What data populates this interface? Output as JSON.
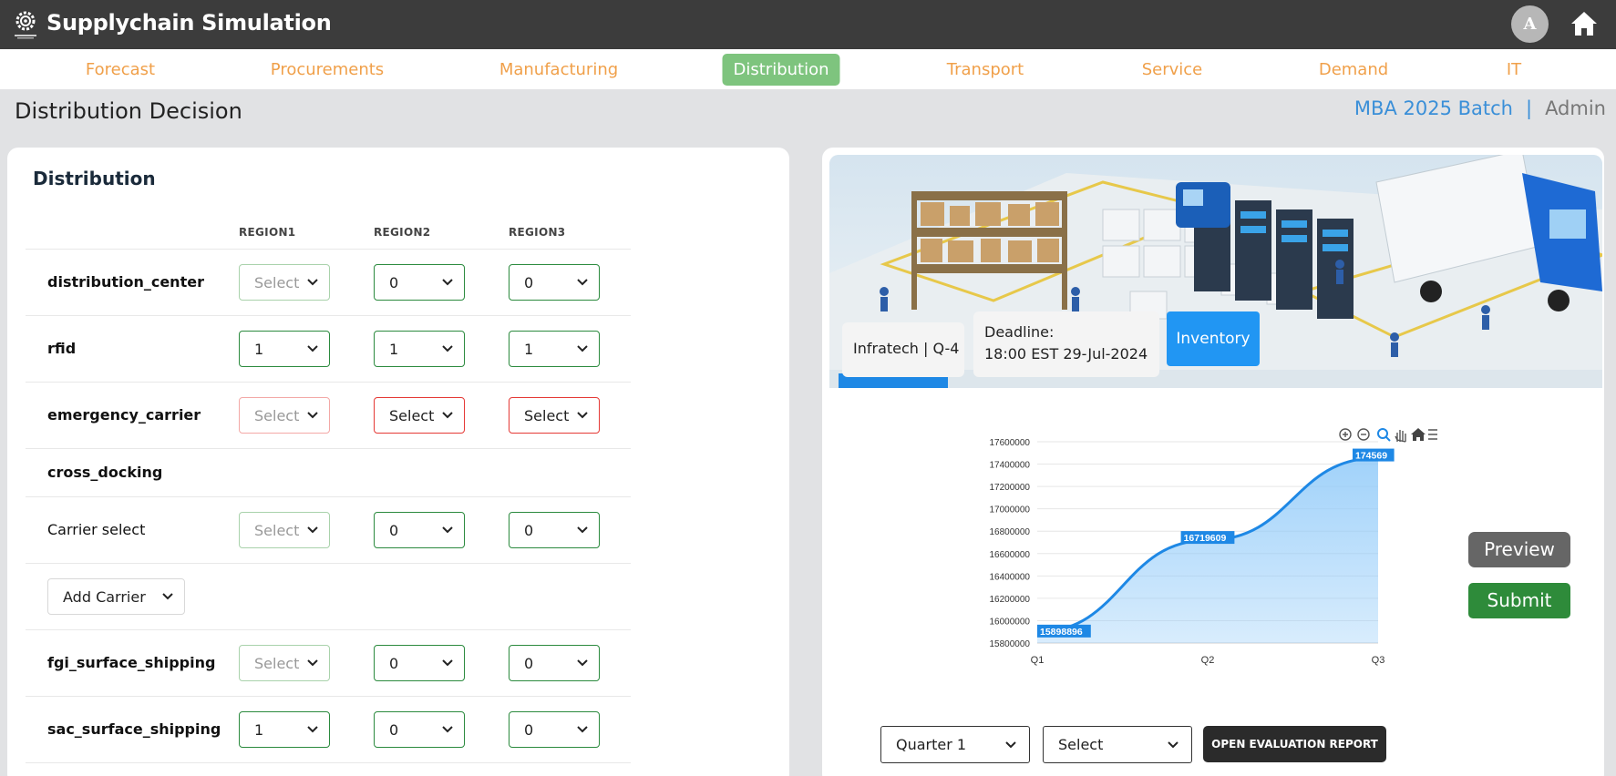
{
  "app": {
    "title": "Supplychain Simulation",
    "avatar_letter": "A"
  },
  "nav": {
    "items": [
      {
        "label": "Forecast",
        "active": false
      },
      {
        "label": "Procurements",
        "active": false
      },
      {
        "label": "Manufacturing",
        "active": false
      },
      {
        "label": "Distribution",
        "active": true
      },
      {
        "label": "Transport",
        "active": false
      },
      {
        "label": "Service",
        "active": false
      },
      {
        "label": "Demand",
        "active": false
      },
      {
        "label": "IT",
        "active": false
      }
    ]
  },
  "header": {
    "page_title": "Distribution Decision",
    "batch": "MBA 2025 Batch",
    "separator": "|",
    "role": "Admin"
  },
  "distribution": {
    "title": "Distribution",
    "columns": [
      "REGION1",
      "REGION2",
      "REGION3"
    ],
    "rows": [
      {
        "label": "distribution_center",
        "values": [
          "Select",
          "0",
          "0"
        ]
      },
      {
        "label": "rfid",
        "values": [
          "1",
          "1",
          "1"
        ]
      },
      {
        "label": "emergency_carrier",
        "values": [
          "Select",
          "Select",
          "Select"
        ]
      },
      {
        "label": "cross_docking"
      },
      {
        "label": "Carrier select",
        "values": [
          "Select",
          "0",
          "0"
        ]
      },
      {
        "label": "fgi_surface_shipping",
        "values": [
          "Select",
          "0",
          "0"
        ]
      },
      {
        "label": "sac_surface_shipping",
        "values": [
          "1",
          "0",
          "0"
        ]
      }
    ],
    "add_carrier_label": "Add Carrier"
  },
  "hero": {
    "company": "Infratech | Q-4",
    "deadline_label": "Deadline:",
    "deadline_value": "18:00 EST 29-Jul-2024",
    "inventory_button": "Inventory"
  },
  "chart_data": {
    "type": "area",
    "categories": [
      "Q1",
      "Q2",
      "Q3"
    ],
    "series": [
      {
        "values": [
          15898896,
          16719609,
          17456900
        ]
      }
    ],
    "data_labels": [
      "15898896",
      "16719609",
      "174569"
    ],
    "y_ticks": [
      "17600000",
      "17400000",
      "17200000",
      "17000000",
      "16800000",
      "16600000",
      "16400000",
      "16200000",
      "16000000",
      "15800000"
    ],
    "ylim": [
      15800000,
      17600000
    ],
    "title": "",
    "xlabel": "",
    "ylabel": "",
    "grid": true,
    "colors": {
      "line": "#1e88e5",
      "fill": "#90caf9",
      "label_bg": "#1e88e5"
    }
  },
  "chart_toolbar": [
    "zoom-in-icon",
    "zoom-out-icon",
    "magnifier-icon",
    "pan-hand-icon",
    "home-icon",
    "menu-icon"
  ],
  "actions": {
    "preview": "Preview",
    "submit": "Submit"
  },
  "footer": {
    "quarter_value": "Quarter 1",
    "select_value": "Select",
    "eval_button": "OPEN EVALUATION REPORT"
  }
}
